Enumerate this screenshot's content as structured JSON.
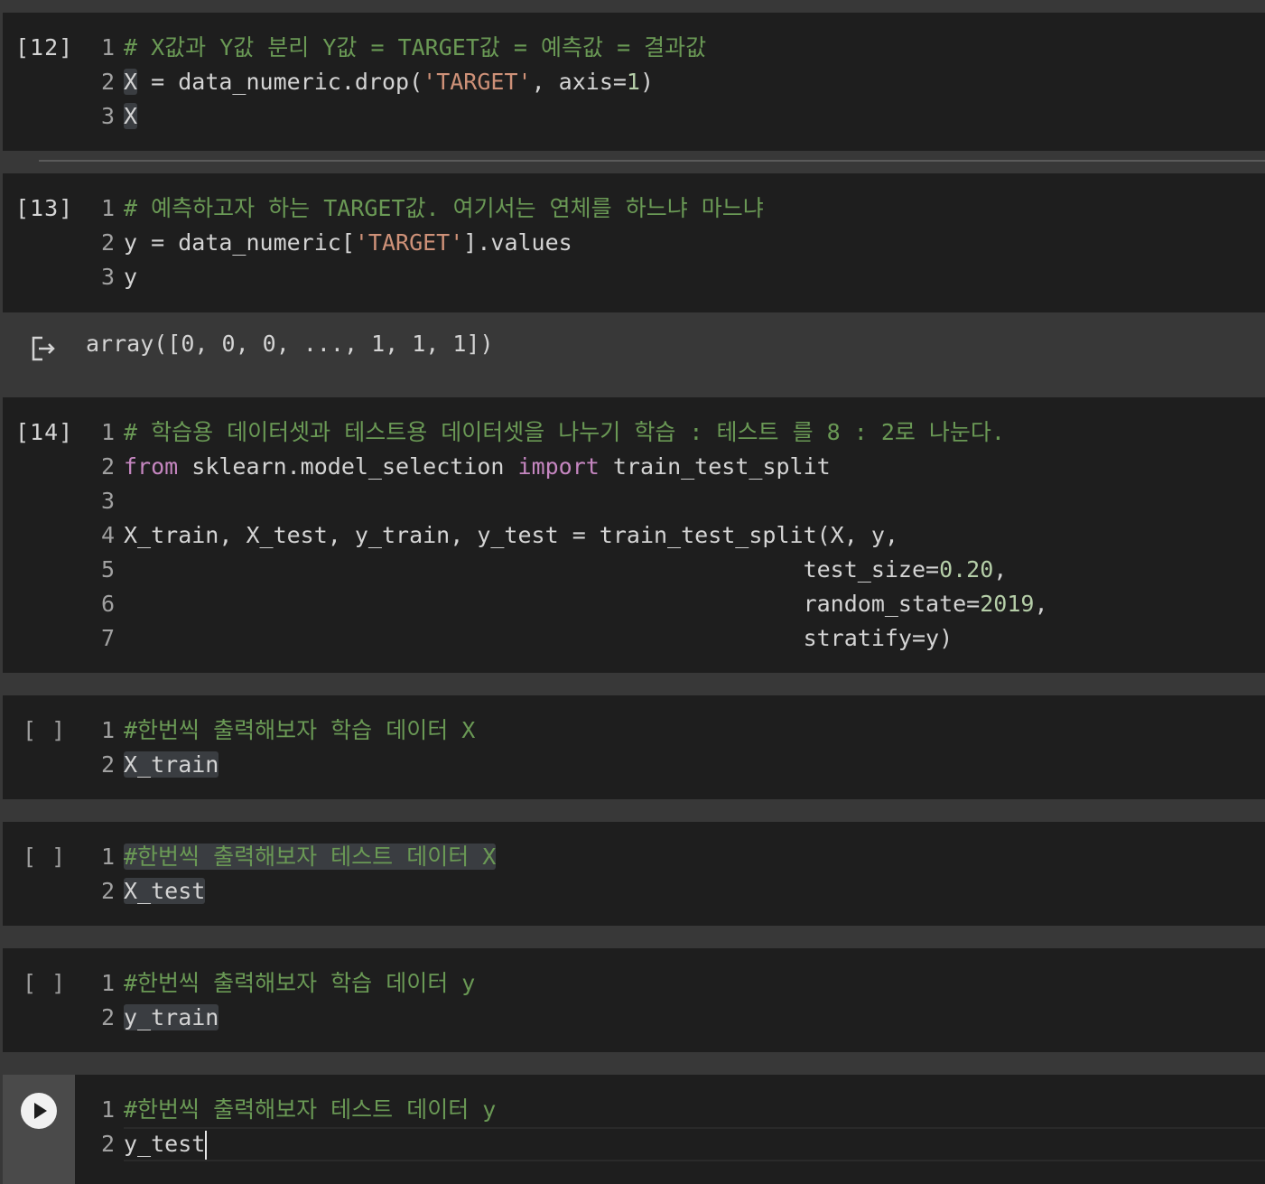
{
  "cells": [
    {
      "exec": "[12]",
      "lines": [
        {
          "n": "1",
          "parts": [
            {
              "t": "# X값과 Y값 분리 Y값 = TARGET값 = 예측값 = 결과값",
              "c": "cm"
            }
          ]
        },
        {
          "n": "2",
          "parts": [
            {
              "t": "X",
              "c": "sel"
            },
            {
              "t": " = data_numeric.drop("
            },
            {
              "t": "'TARGET'",
              "c": "str"
            },
            {
              "t": ", axis="
            },
            {
              "t": "1",
              "c": "num"
            },
            {
              "t": ")"
            }
          ]
        },
        {
          "n": "3",
          "parts": [
            {
              "t": "X",
              "c": "sel"
            }
          ]
        }
      ]
    },
    {
      "exec": "[13]",
      "lines": [
        {
          "n": "1",
          "parts": [
            {
              "t": "# 예측하고자 하는 TARGET값. 여기서는 연체를 하느냐 마느냐",
              "c": "cm"
            }
          ]
        },
        {
          "n": "2",
          "parts": [
            {
              "t": "y = data_numeric["
            },
            {
              "t": "'TARGET'",
              "c": "str"
            },
            {
              "t": "].values"
            }
          ]
        },
        {
          "n": "3",
          "parts": [
            {
              "t": "y"
            }
          ]
        }
      ],
      "output": "array([0, 0, 0, ..., 1, 1, 1])"
    },
    {
      "exec": "[14]",
      "lines": [
        {
          "n": "1",
          "parts": [
            {
              "t": "# 학습용 데이터셋과 테스트용 데이터셋을 나누기 학습 : 테스트 를 8 : 2로 나눈다.",
              "c": "cm"
            }
          ]
        },
        {
          "n": "2",
          "parts": [
            {
              "t": "from",
              "c": "kw"
            },
            {
              "t": " sklearn.model_selection "
            },
            {
              "t": "import",
              "c": "kw"
            },
            {
              "t": " train_test_split"
            }
          ]
        },
        {
          "n": "3",
          "parts": []
        },
        {
          "n": "4",
          "parts": [
            {
              "t": "X_train, X_test, y_train, y_test = train_test_split(X, y,"
            }
          ]
        },
        {
          "n": "5",
          "parts": [
            {
              "t": "                                                  test_size="
            },
            {
              "t": "0.20",
              "c": "num"
            },
            {
              "t": ","
            }
          ]
        },
        {
          "n": "6",
          "parts": [
            {
              "t": "                                                  random_state="
            },
            {
              "t": "2019",
              "c": "num"
            },
            {
              "t": ","
            }
          ]
        },
        {
          "n": "7",
          "parts": [
            {
              "t": "                                                  stratify=y)"
            }
          ]
        }
      ]
    },
    {
      "exec": "[ ]",
      "lines": [
        {
          "n": "1",
          "parts": [
            {
              "t": "#한번씩 출력해보자 학습 데이터 X",
              "c": "cm"
            }
          ]
        },
        {
          "n": "2",
          "parts": [
            {
              "t": "X_train",
              "c": "sel"
            }
          ]
        }
      ]
    },
    {
      "exec": "[ ]",
      "lines": [
        {
          "n": "1",
          "parts": [
            {
              "t": "#한번씩 출력해보자 테스트 데이터 X",
              "c": "cm sel"
            }
          ]
        },
        {
          "n": "2",
          "parts": [
            {
              "t": "X_test",
              "c": "sel"
            }
          ]
        }
      ]
    },
    {
      "exec": "[ ]",
      "lines": [
        {
          "n": "1",
          "parts": [
            {
              "t": "#한번씩 출력해보자 학습 데이터 y",
              "c": "cm"
            }
          ]
        },
        {
          "n": "2",
          "parts": [
            {
              "t": "y_train",
              "c": "sel"
            }
          ]
        }
      ]
    },
    {
      "exec": "",
      "run_icon": "play-icon",
      "lines": [
        {
          "n": "1",
          "parts": [
            {
              "t": "#한번씩 출력해보자 테스트 데이터 y",
              "c": "cm"
            }
          ]
        },
        {
          "n": "2",
          "parts": [
            {
              "t": "y_test"
            }
          ]
        }
      ]
    }
  ]
}
